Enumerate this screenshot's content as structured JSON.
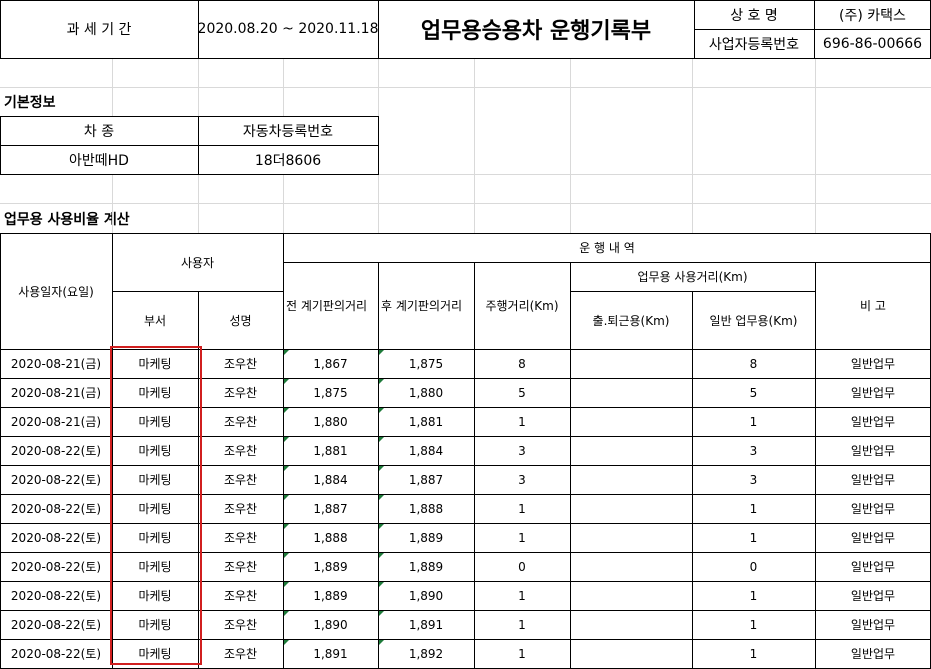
{
  "header": {
    "period_label": "과  세  기  간",
    "period_value": "2020.08.20 ~ 2020.11.18",
    "title": "업무용승용차 운행기록부",
    "company_label": "상    호    명",
    "company_value": "(주) 카택스",
    "bizno_label": "사업자등록번호",
    "bizno_value": "696-86-00666"
  },
  "basic_info": {
    "section_title": "기본정보",
    "car_type_label": "차        종",
    "car_type_value": "아반떼HD",
    "plate_label": "자동차등록번호",
    "plate_value": "18더8606"
  },
  "usage": {
    "section_title": "업무용 사용비율 계산",
    "col_date": "사용일자(요일)",
    "col_user": "사용자",
    "col_dept": "부서",
    "col_name": "성명",
    "col_operation": "운      행      내      역",
    "col_before": "전 계기판의거리",
    "col_after": "후 계기판의거리",
    "col_distance": "주행거리(Km)",
    "col_business_group": "업무용 사용거리(Km)",
    "col_commute": "출.퇴근용(Km)",
    "col_general": "일반 업무용(Km)",
    "col_note": "비      고",
    "rows": [
      {
        "date": "2020-08-21(금)",
        "dept": "마케팅",
        "name": "조우찬",
        "before": "1,867",
        "after": "1,875",
        "distance": "8",
        "commute": "",
        "general": "8",
        "note": "일반업무"
      },
      {
        "date": "2020-08-21(금)",
        "dept": "마케팅",
        "name": "조우찬",
        "before": "1,875",
        "after": "1,880",
        "distance": "5",
        "commute": "",
        "general": "5",
        "note": "일반업무"
      },
      {
        "date": "2020-08-21(금)",
        "dept": "마케팅",
        "name": "조우찬",
        "before": "1,880",
        "after": "1,881",
        "distance": "1",
        "commute": "",
        "general": "1",
        "note": "일반업무"
      },
      {
        "date": "2020-08-22(토)",
        "dept": "마케팅",
        "name": "조우찬",
        "before": "1,881",
        "after": "1,884",
        "distance": "3",
        "commute": "",
        "general": "3",
        "note": "일반업무"
      },
      {
        "date": "2020-08-22(토)",
        "dept": "마케팅",
        "name": "조우찬",
        "before": "1,884",
        "after": "1,887",
        "distance": "3",
        "commute": "",
        "general": "3",
        "note": "일반업무"
      },
      {
        "date": "2020-08-22(토)",
        "dept": "마케팅",
        "name": "조우찬",
        "before": "1,887",
        "after": "1,888",
        "distance": "1",
        "commute": "",
        "general": "1",
        "note": "일반업무"
      },
      {
        "date": "2020-08-22(토)",
        "dept": "마케팅",
        "name": "조우찬",
        "before": "1,888",
        "after": "1,889",
        "distance": "1",
        "commute": "",
        "general": "1",
        "note": "일반업무"
      },
      {
        "date": "2020-08-22(토)",
        "dept": "마케팅",
        "name": "조우찬",
        "before": "1,889",
        "after": "1,889",
        "distance": "0",
        "commute": "",
        "general": "0",
        "note": "일반업무"
      },
      {
        "date": "2020-08-22(토)",
        "dept": "마케팅",
        "name": "조우찬",
        "before": "1,889",
        "after": "1,890",
        "distance": "1",
        "commute": "",
        "general": "1",
        "note": "일반업무"
      },
      {
        "date": "2020-08-22(토)",
        "dept": "마케팅",
        "name": "조우찬",
        "before": "1,890",
        "after": "1,891",
        "distance": "1",
        "commute": "",
        "general": "1",
        "note": "일반업무"
      },
      {
        "date": "2020-08-22(토)",
        "dept": "마케팅",
        "name": "조우찬",
        "before": "1,891",
        "after": "1,892",
        "distance": "1",
        "commute": "",
        "general": "1",
        "note": "일반업무"
      }
    ]
  },
  "colors": {
    "highlight_border": "#d11f1f",
    "comment_marker": "#1e7b3a",
    "gridline": "#d9d9d9"
  }
}
